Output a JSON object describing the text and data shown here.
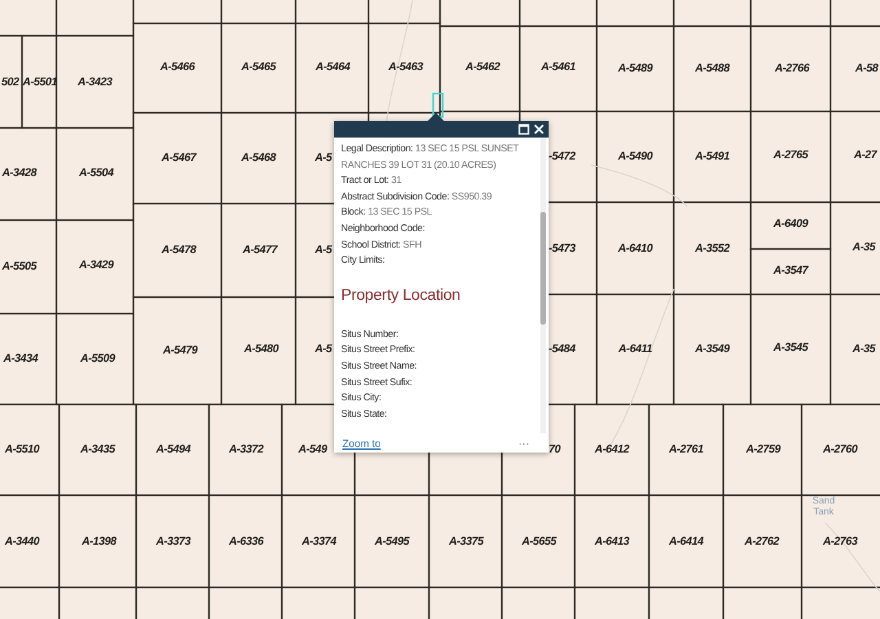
{
  "map": {
    "parcels": [
      "502",
      "A-5501",
      "A-3423",
      "A-5466",
      "A-5465",
      "A-5464",
      "A-5463",
      "A-5462",
      "A-5461",
      "A-5489",
      "A-5488",
      "A-2766",
      "A-58",
      "A-3428",
      "A-5504",
      "A-5467",
      "A-5468",
      "A-5",
      "-5472",
      "A-5490",
      "A-5491",
      "A-2765",
      "A-27",
      "A-5505",
      "A-3429",
      "A-5478",
      "A-5477",
      "A-5",
      "-5473",
      "A-6410",
      "A-3552",
      "A-6409",
      "A-3547",
      "A-35",
      "A-3434",
      "A-5509",
      "A-5479",
      "A-5480",
      "A-5",
      "-5484",
      "A-6411",
      "A-3549",
      "A-3545",
      "A-35",
      "A-5510",
      "A-3435",
      "A-5494",
      "A-3372",
      "A-549",
      "70",
      "A-6412",
      "A-2761",
      "A-2759",
      "A-2760",
      "A-3440",
      "A-1398",
      "A-3373",
      "A-6336",
      "A-3374",
      "A-5495",
      "A-3375",
      "A-5655",
      "A-6413",
      "A-6414",
      "A-2762",
      "A-2763"
    ],
    "place_label": "Sand Tank"
  },
  "popup": {
    "fields": [
      {
        "label": "Legal Description:",
        "value": "13 SEC 15 PSL SUNSET RANCHES 39 LOT 31 (20.10 ACRES)"
      },
      {
        "label": "Tract or Lot:",
        "value": "31"
      },
      {
        "label": "Abstract Subdivision Code:",
        "value": "SS950.39"
      },
      {
        "label": "Block:",
        "value": "13 SEC 15 PSL"
      },
      {
        "label": "Neighborhood Code:"
      },
      {
        "label": "School District:",
        "value": "SFH"
      },
      {
        "label": "City Limits:"
      }
    ],
    "section_title": "Property Location",
    "location_fields": [
      {
        "label": "Situs Number:"
      },
      {
        "label": "Situs Street Prefix:"
      },
      {
        "label": "Situs Street Name:"
      },
      {
        "label": "Situs Street Sufix:"
      },
      {
        "label": "Situs City:"
      },
      {
        "label": "Situs State:"
      }
    ],
    "zoom_link": "Zoom to",
    "more": "···"
  }
}
